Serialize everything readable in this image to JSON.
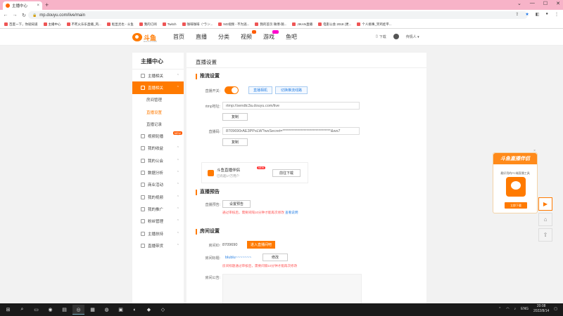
{
  "browser": {
    "tab_title": "主播中心",
    "url": "mp.douyu.com/live/main",
    "bookmarks": [
      "百度一下，你就知道",
      "主播中心",
      "不死火乐乐直播_风...",
      "抠显灵也 - 斗鱼",
      "我的订阅",
      "Twitch",
      "咖啡咖啡（\"ラン...",
      "NG视频 - 不为逃...",
      "我的首页 微博-随...",
      "JIKAN直播",
      "电影公会 2018 (更...",
      "个人搞事_笑鸡娃平..."
    ]
  },
  "header": {
    "logo_text": "斗鱼",
    "logo_sub": "DOUYU.COM",
    "nav": [
      {
        "label": "首页",
        "badge": false
      },
      {
        "label": "直播",
        "badge": false
      },
      {
        "label": "分类",
        "badge": false
      },
      {
        "label": "视频",
        "badge": true
      },
      {
        "label": "游戏",
        "badge": "new"
      },
      {
        "label": "鱼吧",
        "badge": false
      }
    ],
    "download": "下载",
    "username": "传情人"
  },
  "sidebar": {
    "title": "主播中心",
    "items": [
      {
        "label": "主播相关",
        "type": "item"
      },
      {
        "label": "直播相关",
        "type": "active"
      },
      {
        "label": "房间管理",
        "type": "sub"
      },
      {
        "label": "直播设置",
        "type": "sub-on"
      },
      {
        "label": "直播记录",
        "type": "sub"
      },
      {
        "label": "视频轮播",
        "type": "item",
        "hot": "NEW"
      },
      {
        "label": "我的收益",
        "type": "item"
      },
      {
        "label": "我的公会",
        "type": "item"
      },
      {
        "label": "数据分析",
        "type": "item"
      },
      {
        "label": "商业活动",
        "type": "item"
      },
      {
        "label": "我的视频",
        "type": "item"
      },
      {
        "label": "我的推广",
        "type": "item"
      },
      {
        "label": "粉丝管理",
        "type": "item"
      },
      {
        "label": "主播扶持",
        "type": "item"
      },
      {
        "label": "直播带货",
        "type": "item"
      }
    ]
  },
  "content": {
    "page_title": "直播设置",
    "stream": {
      "section": "推流设置",
      "switch_label": "直播开关:",
      "btn_camera": "直播相机",
      "btn_area": "切换推流线路",
      "rtmp_label": "rtmp地址:",
      "rtmp_value": "rtmp://sendtc3a.douyu.com/live",
      "copy1": "复制",
      "code_label": "直播码:",
      "code_value": "8709690rAE3PPsLW?wsSecret=********************************&ws7",
      "copy2": "复制"
    },
    "promo": {
      "title": "斗鱼直播伴侣",
      "new_tag": "NEW",
      "sub": "已有超17万用户",
      "btn": "前往下载"
    },
    "preview": {
      "section": "直播预告",
      "label": "直播预告:",
      "btn": "设置预告",
      "note": "通过审核后，需要间隔10分钟才能再次修改",
      "note_link": "查看说明"
    },
    "room": {
      "section": "房间设置",
      "id_label": "房间ID:",
      "id_value": "8709690",
      "enter_btn": "进入直播间吧",
      "name_label": "房间标题:",
      "name_value": "blublu~~~~~~~",
      "edit_btn": "修改",
      "note": "房间标题通过审核后，需要间隔10分钟才能再次修改",
      "notice_label": "房间公告:"
    }
  },
  "float_ad": {
    "title": "斗鱼直播伴侣",
    "desc": "最好用的PC端直播工具",
    "btn": "立即下载"
  },
  "taskbar": {
    "lang": "ENG",
    "time": "20:08",
    "date": "2022/8/14"
  }
}
